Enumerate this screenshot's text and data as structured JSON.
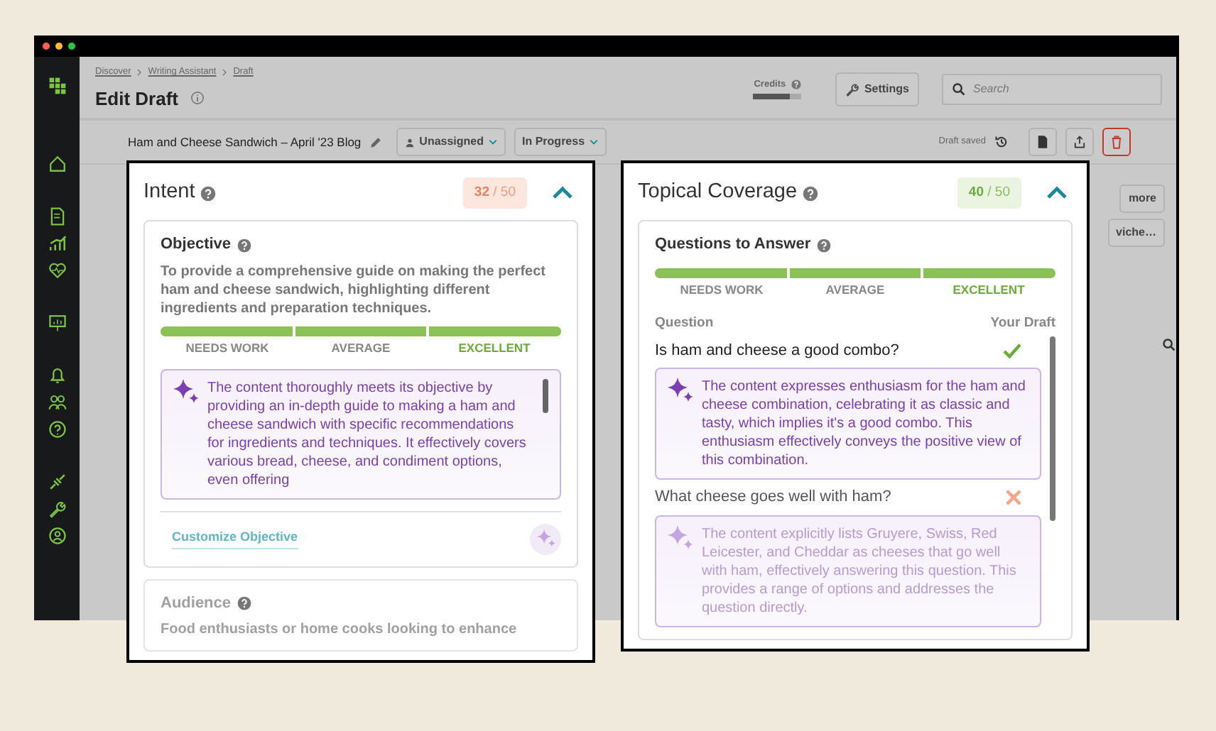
{
  "breadcrumb": [
    "Discover",
    "Writing Assistant",
    "Draft"
  ],
  "page_title": "Edit Draft",
  "credits": {
    "label": "Credits",
    "level": 0.75
  },
  "settings_button": "Settings",
  "search": {
    "placeholder": "Search"
  },
  "draft": {
    "title": "Ham and Cheese Sandwich – April '23 Blog",
    "assignee": "Unassigned",
    "status": "In Progress",
    "save_status": "Draft saved"
  },
  "background_buttons": [
    "more",
    "viche…"
  ],
  "intent_panel": {
    "title": "Intent",
    "score": "32",
    "score_total": "/ 50",
    "kind": "warning",
    "expanded": true,
    "objective": {
      "title": "Objective",
      "text": "To provide a comprehensive guide on making the perfect ham and cheese sandwich, highlighting different ingredients and preparation techniques.",
      "rating": {
        "level": 1,
        "labels": [
          {
            "label": "NEEDS WORK",
            "selected": false
          },
          {
            "label": "AVERAGE",
            "selected": false
          },
          {
            "label": "EXCELLENT",
            "selected": true
          }
        ]
      },
      "feedback": "The content thoroughly meets its objective by providing an in-depth guide to making a ham and cheese sandwich with specific recommendations for ingredients and techniques. It effectively covers various bread, cheese, and condiment options, even offering",
      "link": "Customize Objective"
    },
    "audience": {
      "title": "Audience",
      "text": "Food enthusiasts or home cooks looking to enhance"
    }
  },
  "topical_coverage_panel": {
    "title": "Topical Coverage",
    "score": "40",
    "score_total": "/ 50",
    "kind": "success",
    "expanded": true,
    "questions_section": {
      "title": "Questions to Answer",
      "rating": {
        "level": 1,
        "labels": [
          {
            "label": "NEEDS WORK",
            "selected": false
          },
          {
            "label": "AVERAGE",
            "selected": false
          },
          {
            "label": "EXCELLENT",
            "selected": true
          }
        ]
      },
      "column_headers": [
        "Question",
        "Your Draft"
      ],
      "questions": [
        {
          "text": "Is ham and cheese a good combo?",
          "answered": true,
          "feedback": "The content expresses enthusiasm for the ham and cheese combination, celebrating it as classic and tasty, which implies it's a good combo. This enthusiasm effectively conveys the positive view of this combination."
        },
        {
          "text": "What cheese goes well with ham?",
          "answered": false,
          "feedback": "The content explicitly lists Gruyere, Swiss, Red Leicester, and Cheddar as cheeses that go well with ham, effectively answering this question. This provides a range of options and addresses the question directly."
        }
      ]
    }
  }
}
